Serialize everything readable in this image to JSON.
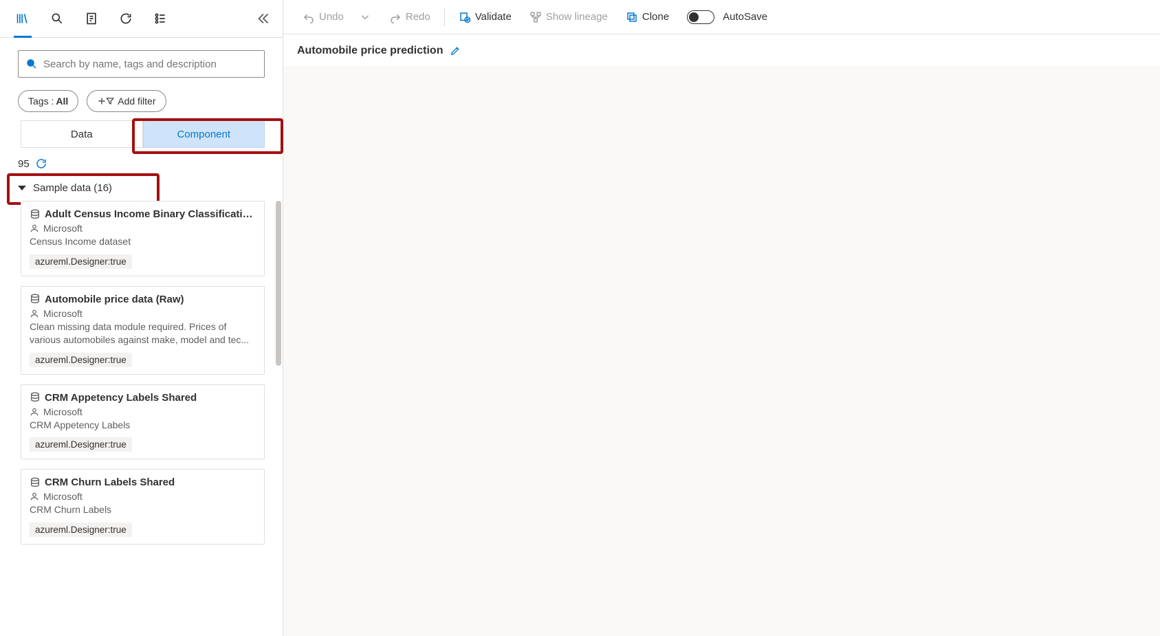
{
  "search": {
    "placeholder": "Search by name, tags and description"
  },
  "tags_pill": {
    "prefix": "Tags : ",
    "value": "All"
  },
  "filter_pill": "Add filter",
  "tabs": {
    "data": "Data",
    "component": "Component"
  },
  "count": "95",
  "section": {
    "name": "Sample data",
    "count": "(16)"
  },
  "cards": [
    {
      "title": "Adult Census Income Binary Classification dat...",
      "author": "Microsoft",
      "desc": "Census Income dataset",
      "tag": "azureml.Designer:true"
    },
    {
      "title": "Automobile price data (Raw)",
      "author": "Microsoft",
      "desc": "Clean missing data module required. Prices of various automobiles against make, model and tec...",
      "tag": "azureml.Designer:true"
    },
    {
      "title": "CRM Appetency Labels Shared",
      "author": "Microsoft",
      "desc": "CRM Appetency Labels",
      "tag": "azureml.Designer:true"
    },
    {
      "title": "CRM Churn Labels Shared",
      "author": "Microsoft",
      "desc": "CRM Churn Labels",
      "tag": "azureml.Designer:true"
    }
  ],
  "toolbar": {
    "undo": "Undo",
    "redo": "Redo",
    "validate": "Validate",
    "lineage": "Show lineage",
    "clone": "Clone",
    "autosave": "AutoSave"
  },
  "pipeline_title": "Automobile price prediction",
  "colors": {
    "accent": "#0078d4",
    "highlight": "#a50f12"
  }
}
